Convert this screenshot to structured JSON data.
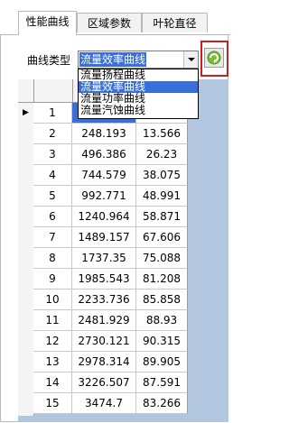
{
  "tabs": [
    "性能曲线",
    "区域参数",
    "叶轮直径"
  ],
  "curve_type_label": "曲线类型",
  "combo": {
    "selected": "流量效率曲线"
  },
  "dropdown_options": [
    "流量扬程曲线",
    "流量效率曲线",
    "流量功率曲线",
    "流量汽蚀曲线"
  ],
  "dropdown_selected_index": 1,
  "current_row_marker": "▶",
  "rows": [
    {
      "no": "1",
      "q": "",
      "h": ""
    },
    {
      "no": "2",
      "q": "248.193",
      "h": "13.566"
    },
    {
      "no": "3",
      "q": "496.386",
      "h": "26.23"
    },
    {
      "no": "4",
      "q": "744.579",
      "h": "38.075"
    },
    {
      "no": "5",
      "q": "992.771",
      "h": "48.991"
    },
    {
      "no": "6",
      "q": "1240.964",
      "h": "58.871"
    },
    {
      "no": "7",
      "q": "1489.157",
      "h": "67.606"
    },
    {
      "no": "8",
      "q": "1737.35",
      "h": "75.088"
    },
    {
      "no": "9",
      "q": "1985.543",
      "h": "81.208"
    },
    {
      "no": "10",
      "q": "2233.736",
      "h": "85.858"
    },
    {
      "no": "11",
      "q": "2481.929",
      "h": "88.93"
    },
    {
      "no": "12",
      "q": "2730.121",
      "h": "90.315"
    },
    {
      "no": "13",
      "q": "2978.314",
      "h": "89.905"
    },
    {
      "no": "14",
      "q": "3226.507",
      "h": "87.591"
    },
    {
      "no": "15",
      "q": "3474.7",
      "h": "83.266"
    }
  ],
  "colors": {
    "selection": "#3a6fd8",
    "grid_background": "#b3c6e0",
    "highlight_frame": "#c81f1f",
    "refresh_icon": "#6aa82a"
  },
  "icons": {
    "refresh": "refresh-icon",
    "dropdown": "chevron-down-icon"
  }
}
